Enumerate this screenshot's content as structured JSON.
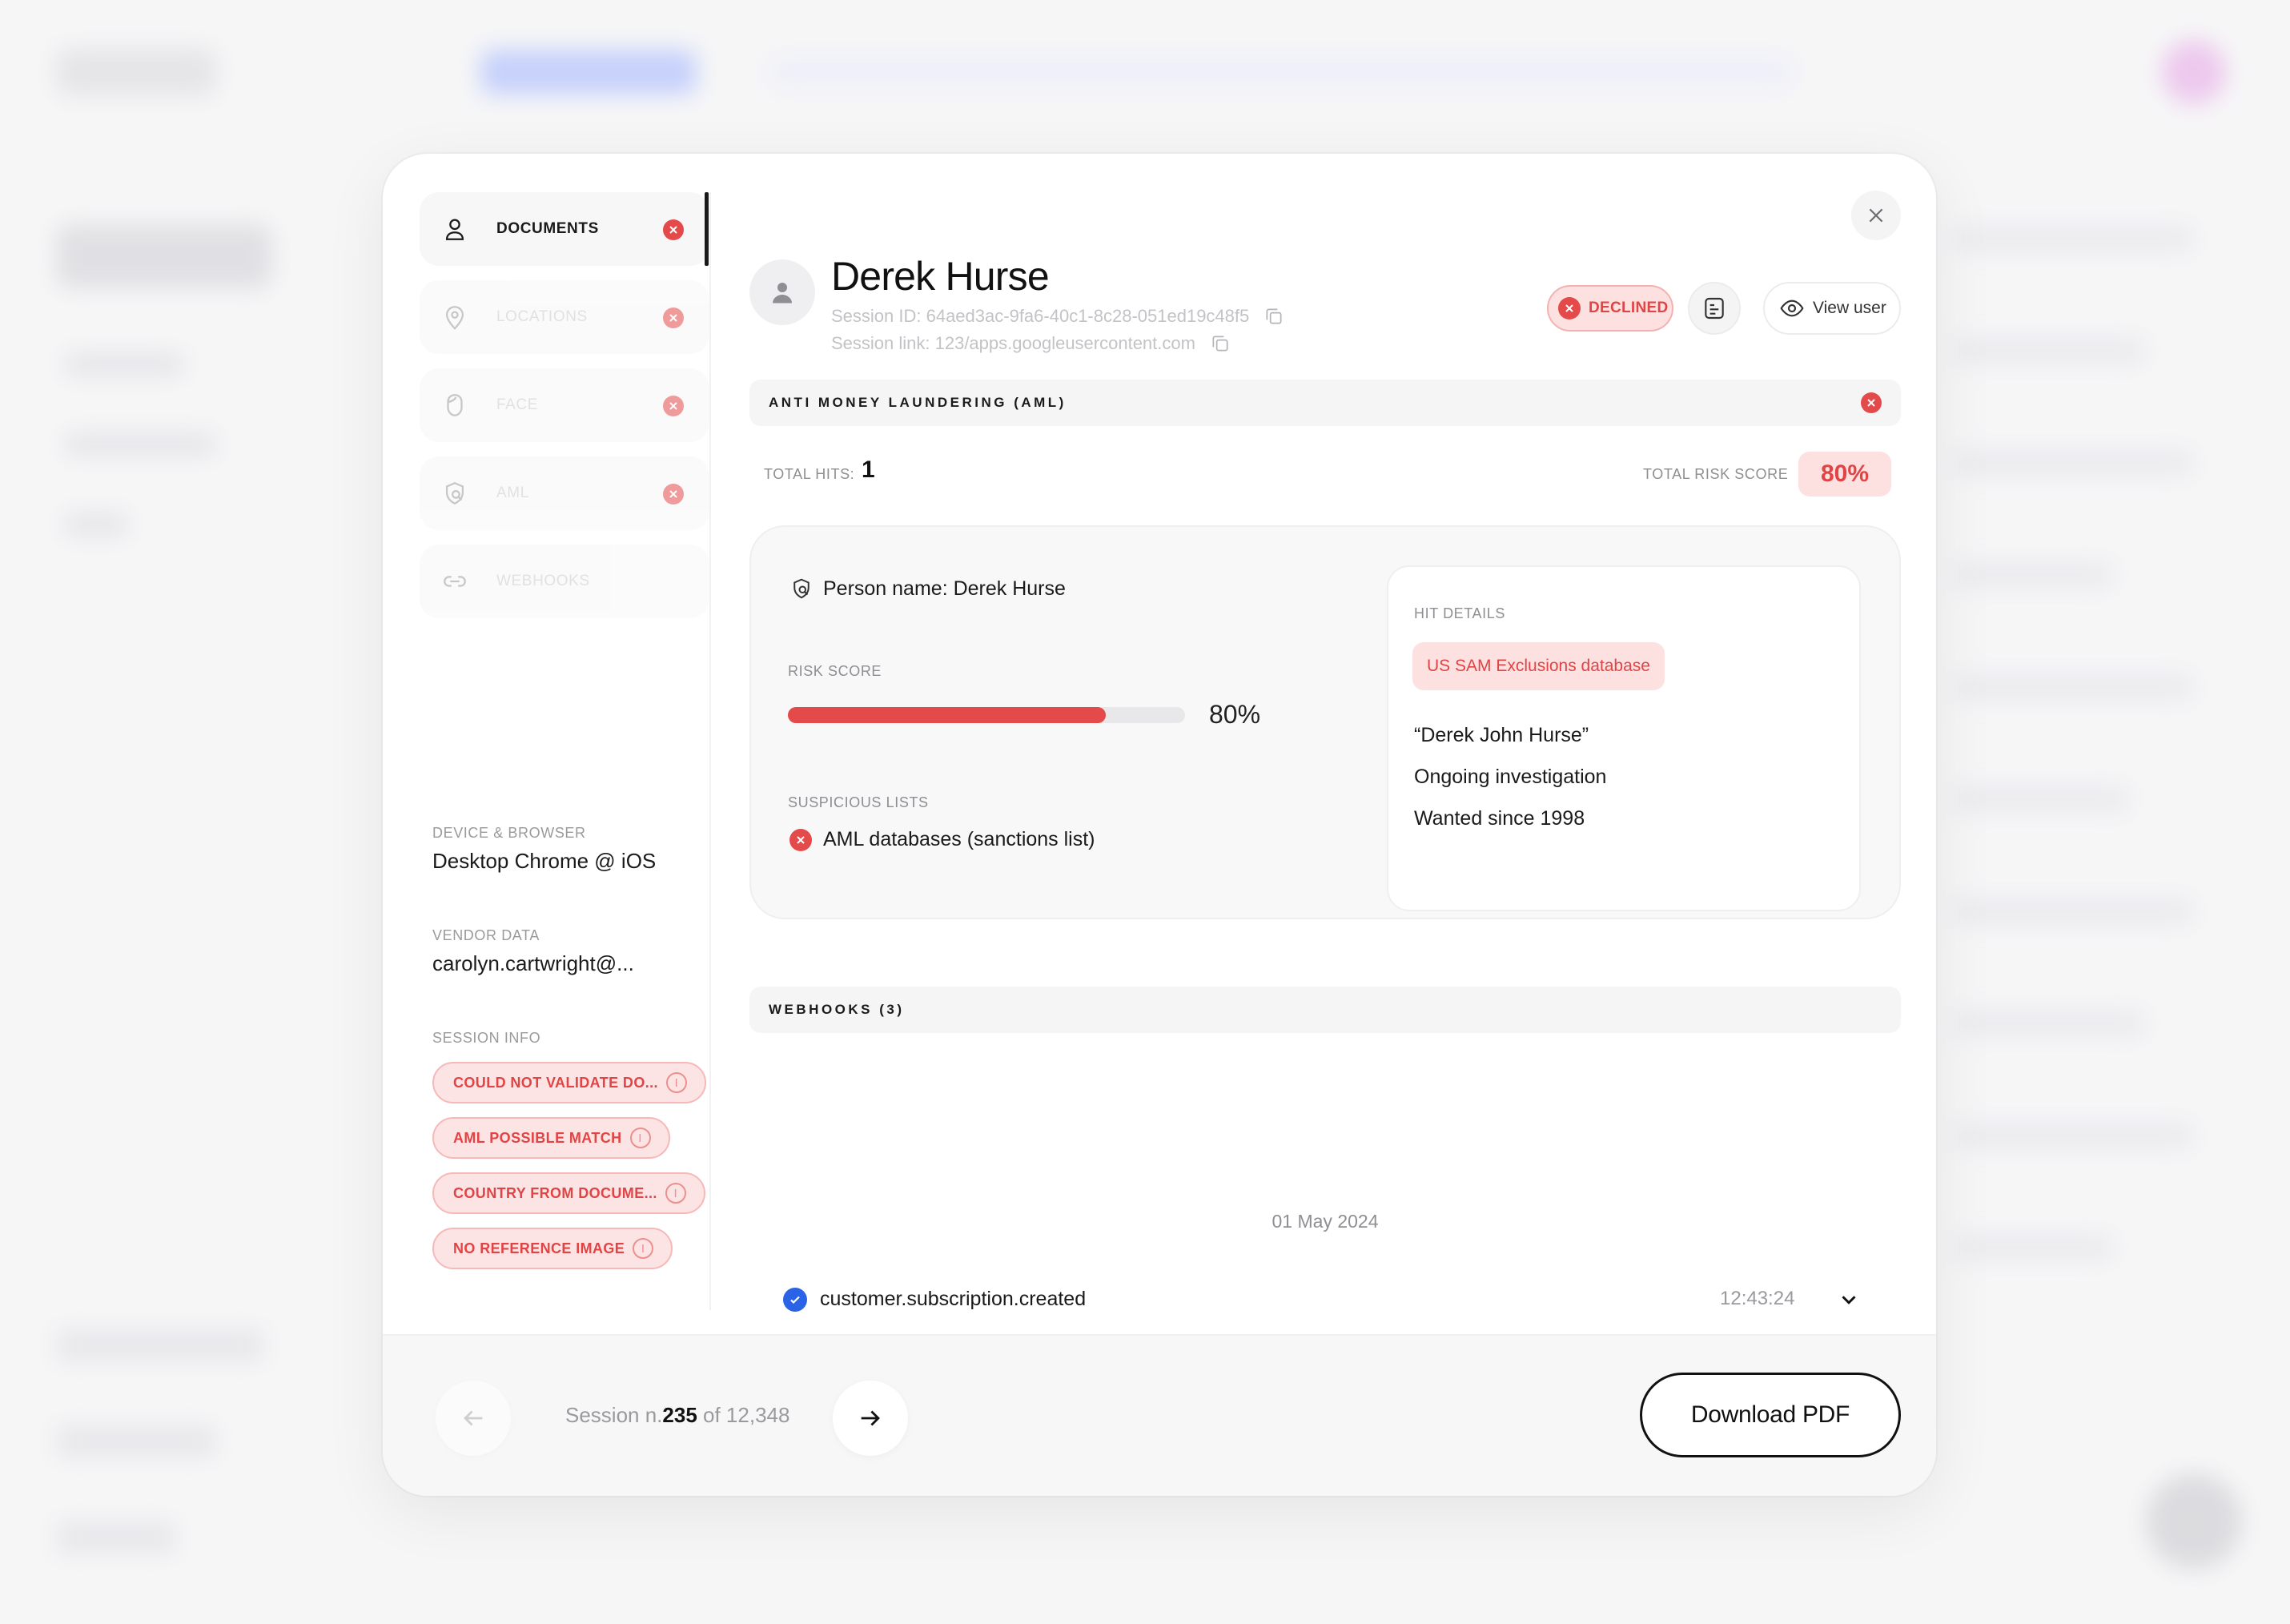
{
  "nav": {
    "items": [
      {
        "label": "Documents",
        "icon": "user-icon",
        "status": "error"
      },
      {
        "label": "Locations",
        "icon": "location-pin-icon",
        "status": "error"
      },
      {
        "label": "Face",
        "icon": "face-icon",
        "status": "error"
      },
      {
        "label": "AML",
        "icon": "aml-search-icon",
        "status": "error"
      },
      {
        "label": "Webhooks",
        "icon": "link-icon",
        "status": "none"
      }
    ]
  },
  "meta": {
    "device_label": "Device & Browser",
    "device_value": "Desktop Chrome @ iOS",
    "vendor_label": "Vendor data",
    "vendor_value": "carolyn.cartwright@...",
    "session_info_label": "Session info",
    "chips": [
      "Could not validate do...",
      "AML possible match",
      "Country from docume...",
      "No reference image"
    ]
  },
  "header": {
    "name": "Derek Hurse",
    "session_id": "Session ID: 64aed3ac-9fa6-40c1-8c28-051ed19c48f5",
    "session_link": "Session link: 123/apps.googleusercontent.com",
    "status": "DECLINED",
    "view_user": "View user"
  },
  "aml": {
    "title": "Anti Money Laundering (AML)",
    "total_hits_label": "Total hits:",
    "total_hits": "1",
    "total_risk_label": "Total risk score",
    "total_risk": "80%",
    "person": "Person name: Derek Hurse",
    "risk_score_label": "Risk score",
    "risk_score_value": "80%",
    "risk_score_fraction": 0.8,
    "suspicious_label": "Suspicious lists",
    "suspicious_item": "AML databases (sanctions list)",
    "hit_details_label": "Hit details",
    "hit_db": "US SAM Exclusions database",
    "hit_lines": [
      "“Derek John Hurse”",
      "Ongoing investigation",
      "Wanted since 1998"
    ]
  },
  "webhooks": {
    "title": "Webhooks (3)",
    "date": "01 May 2024",
    "event": "customer.subscription.created",
    "time": "12:43:24"
  },
  "footer": {
    "pager_prefix": "Session n.",
    "pager_current": "235",
    "pager_suffix": " of 12,348",
    "download": "Download PDF"
  },
  "colors": {
    "accent_red": "#e44a4a",
    "accent_blue": "#2b63e6"
  }
}
